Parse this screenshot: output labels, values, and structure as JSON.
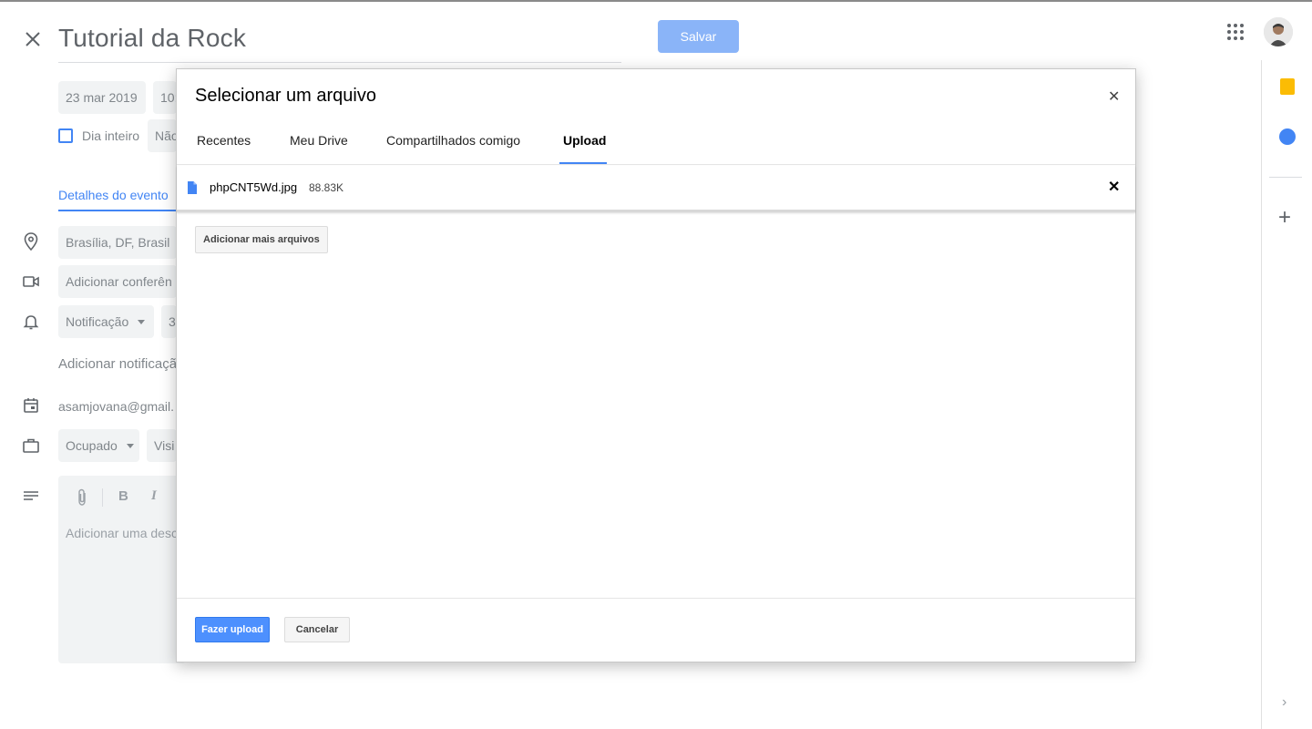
{
  "editor": {
    "title": "Tutorial da Rock",
    "save_label": "Salvar",
    "date": "23 mar 2019",
    "time_partial": "10:",
    "all_day_label": "Dia inteiro",
    "repeat_partial": "Não",
    "details_tab": "Detalhes do evento",
    "location": "Brasília, DF, Brasil",
    "conference": "Adicionar conferên",
    "notification_type": "Notificação",
    "notification_value_partial": "3",
    "add_notification": "Adicionar notificaçã",
    "calendar_owner": "asamjovana@gmail.",
    "busy_status": "Ocupado",
    "visibility_partial": "Visi",
    "description_placeholder": "Adicionar uma desc"
  },
  "picker": {
    "title": "Selecionar um arquivo",
    "tabs": [
      {
        "label": "Recentes",
        "active": false
      },
      {
        "label": "Meu Drive",
        "active": false
      },
      {
        "label": "Compartilhados comigo",
        "active": false
      },
      {
        "label": "Upload",
        "active": true
      }
    ],
    "file": {
      "name": "phpCNT5Wd.jpg",
      "size": "88.83K"
    },
    "add_more_label": "Adicionar mais arquivos",
    "upload_label": "Fazer upload",
    "cancel_label": "Cancelar"
  },
  "colors": {
    "accent": "#4285f4",
    "save_disabled": "#8ab4f8",
    "upload_btn": "#4d90fe"
  }
}
